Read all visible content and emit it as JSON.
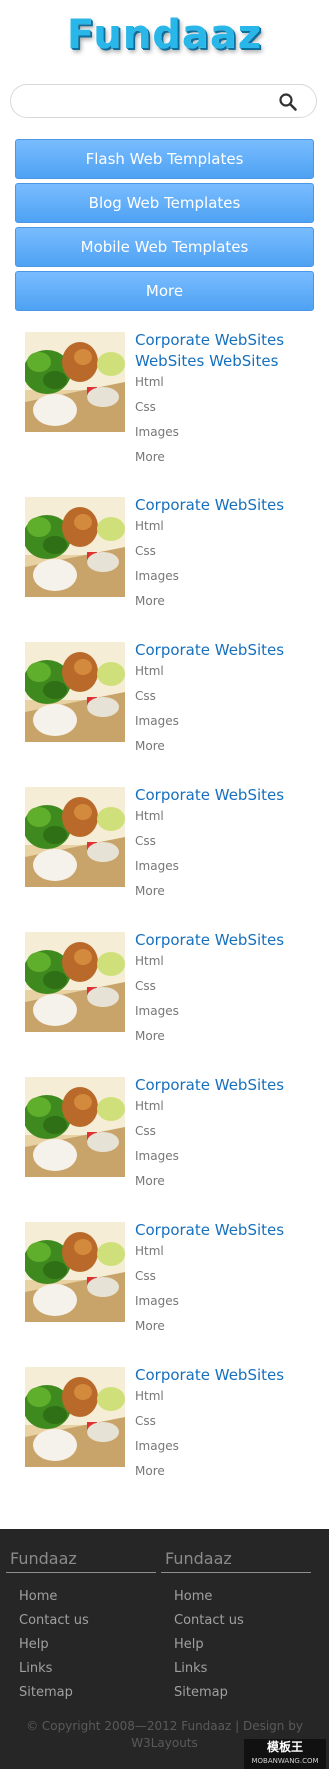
{
  "header": {
    "logo_text": "Fundaaz"
  },
  "search": {
    "placeholder": "",
    "value": "",
    "icon": "search-icon"
  },
  "nav": [
    {
      "label": "Flash Web Templates"
    },
    {
      "label": "Blog Web Templates"
    },
    {
      "label": "Mobile Web Templates"
    },
    {
      "label": "More"
    }
  ],
  "items": [
    {
      "title": "Corporate WebSites WebSites WebSites",
      "links": [
        "Html",
        "Css",
        "Images",
        "More"
      ]
    },
    {
      "title": "Corporate WebSites",
      "links": [
        "Html",
        "Css",
        "Images",
        "More"
      ]
    },
    {
      "title": "Corporate WebSites",
      "links": [
        "Html",
        "Css",
        "Images",
        "More"
      ]
    },
    {
      "title": "Corporate WebSites",
      "links": [
        "Html",
        "Css",
        "Images",
        "More"
      ]
    },
    {
      "title": "Corporate WebSites",
      "links": [
        "Html",
        "Css",
        "Images",
        "More"
      ]
    },
    {
      "title": "Corporate WebSites",
      "links": [
        "Html",
        "Css",
        "Images",
        "More"
      ]
    },
    {
      "title": "Corporate WebSites",
      "links": [
        "Html",
        "Css",
        "Images",
        "More"
      ]
    },
    {
      "title": "Corporate WebSites",
      "links": [
        "Html",
        "Css",
        "Images",
        "More"
      ]
    }
  ],
  "footer": {
    "columns": [
      {
        "heading": "Fundaaz",
        "links": [
          "Home",
          "Contact us",
          "Help",
          "Links",
          "Sitemap"
        ]
      },
      {
        "heading": "Fundaaz",
        "links": [
          "Home",
          "Contact us",
          "Help",
          "Links",
          "Sitemap"
        ]
      }
    ],
    "copyright_line1": "© Copyright 2008—2012 Fundaaz | Design by",
    "copyright_line2": "W3Layouts"
  },
  "watermark": {
    "line1": "模板王",
    "line2": "MOBANWANG.COM"
  },
  "colors": {
    "title_blue": "#1670be",
    "button_blue": "#5aa9f6",
    "footer_bg": "#262626"
  }
}
